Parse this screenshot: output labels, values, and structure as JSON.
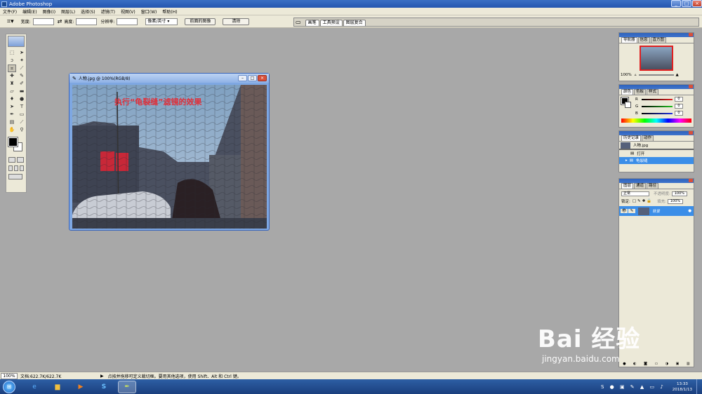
{
  "app": {
    "title": "Adobe Photoshop"
  },
  "menu": [
    "文件(F)",
    "编辑(E)",
    "图像(I)",
    "图层(L)",
    "选择(S)",
    "滤镜(T)",
    "视图(V)",
    "窗口(W)",
    "帮助(H)"
  ],
  "options": {
    "width_label": "宽度:",
    "height_label": "高度:",
    "resolution_label": "分辨率:",
    "unit": "像素/英寸",
    "front_image_btn": "前面的图像",
    "clear_btn": "清除"
  },
  "palette_well_tabs": [
    "画笔",
    "工具预设",
    "图层复合"
  ],
  "document": {
    "title": "人物.jpg @ 100%(RGB/8)",
    "caption": "执行“龟裂缝”滤镜的效果"
  },
  "navigator": {
    "tabs": [
      "导航器",
      "信息",
      "直方图"
    ],
    "zoom": "100%"
  },
  "color_panel": {
    "tabs": [
      "颜色",
      "色板",
      "样式"
    ],
    "channels": [
      {
        "label": "R",
        "value": "0",
        "color": "#d02020"
      },
      {
        "label": "G",
        "value": "0",
        "color": "#20a020"
      },
      {
        "label": "B",
        "value": "0",
        "color": "#2030c0"
      }
    ]
  },
  "history_panel": {
    "tabs": [
      "历史记录",
      "动作"
    ],
    "snapshot": "人物.jpg",
    "items": [
      "打开",
      "龟裂缝"
    ]
  },
  "layers_panel": {
    "tabs": [
      "图层",
      "通道",
      "路径"
    ],
    "blend_mode": "正常",
    "opacity_label": "不透明度:",
    "opacity": "100%",
    "lock_label": "锁定:",
    "fill_label": "填充:",
    "fill": "100%",
    "layer_name": "背景"
  },
  "status": {
    "zoom": "100%",
    "doc_size": "文档:622.7K/622.7K",
    "hint": "点按并拖移可定义裁切框。要用其他选项，使用 Shift、Alt 和 Ctrl 键。"
  },
  "taskbar": {
    "time": "13:33",
    "date": "2018/1/13"
  },
  "watermark": {
    "brand": "Bai 经验",
    "url": "jingyan.baidu.com"
  },
  "colors": {
    "titlebar": "#2456b0",
    "workspace": "#a8a8a8",
    "caption": "#e0303a",
    "selection": "#3b8ee8"
  }
}
